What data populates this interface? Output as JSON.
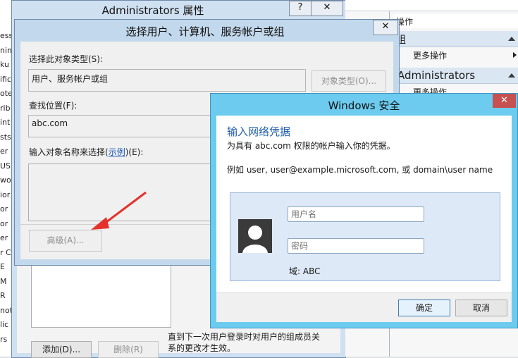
{
  "left_strip": [
    "ess",
    "nin",
    "ku",
    "ific",
    "ote",
    "rib",
    "int",
    "sts",
    "er",
    "US",
    "wo",
    "ior",
    "or",
    "or",
    "er",
    "r C",
    "E",
    "M",
    "R",
    "not",
    "lic",
    "rs"
  ],
  "admin_dialog": {
    "title": "Administrators 属性",
    "help_btn": "?",
    "close_btn": "✕",
    "note": "直到下一次用户登录时对用户的组成员关系的更改才生效。",
    "add_btn": "添加(D)...",
    "remove_btn": "删除(R)"
  },
  "right_panel": {
    "header": "操作",
    "group_header": "组",
    "more_actions_1": "更多操作",
    "admin_header": "Administrators",
    "more_actions_2": "更多操作"
  },
  "select_dialog": {
    "title": "选择用户、计算机、服务帐户或组",
    "close_btn": "✕",
    "object_type_label": "选择此对象类型(S):",
    "object_type_value": "用户、服务帐户或组",
    "object_type_btn": "对象类型(O)...",
    "location_label": "查找位置(F):",
    "location_value": "abc.com",
    "enter_names_label_pre": "输入对象名称来选择(",
    "enter_names_link": "示例",
    "enter_names_label_post": ")(E):",
    "advanced_btn": "高级(A)..."
  },
  "security_dialog": {
    "title": "Windows 安全",
    "close_btn": "✕",
    "heading": "输入网络凭据",
    "subtitle": "为具有 abc.com 权限的帐户输入你的凭据。",
    "example": "例如 user, user@example.microsoft.com, 或 domain\\user name",
    "username_placeholder": "用户名",
    "password_placeholder": "密码",
    "domain": "域: ABC",
    "ok_btn": "确定",
    "cancel_btn": "取消"
  },
  "colors": {
    "security_title_bg": "#6ccbee",
    "credential_bg": "#dde9f7",
    "close_red": "#c75050",
    "heading_blue": "#1f5da8",
    "arrow_red": "#e4322b"
  },
  "icons": {
    "avatar": "user-avatar-icon",
    "arrow": "red-arrow-icon"
  }
}
